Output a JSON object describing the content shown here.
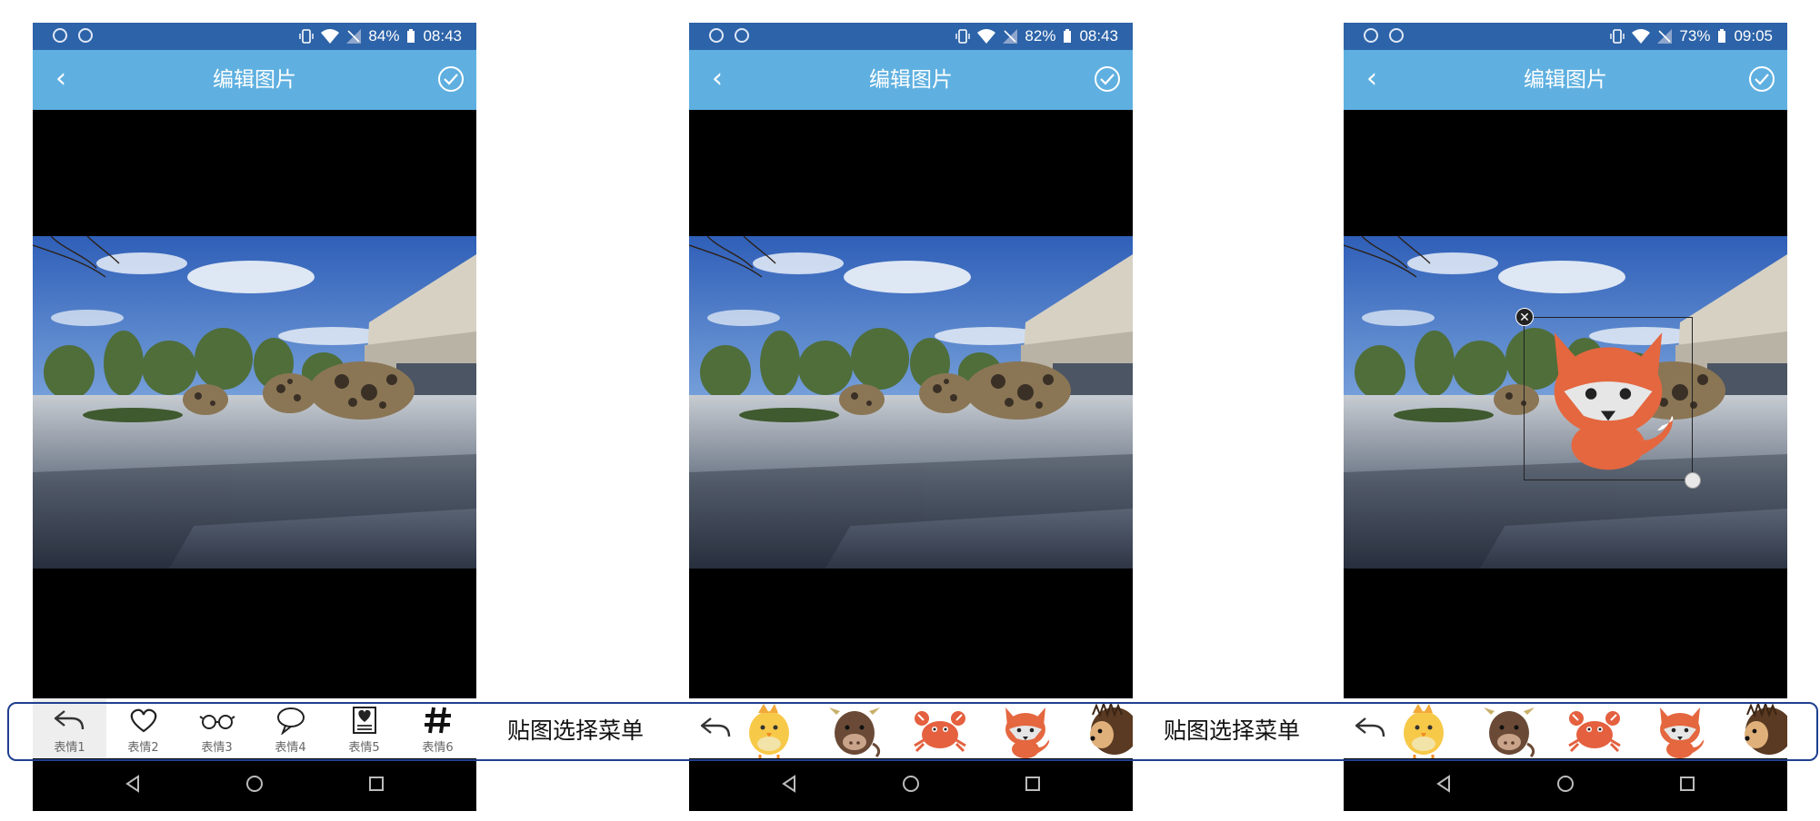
{
  "colors": {
    "status_bar": "#2d63a8",
    "app_bar": "#5fb0e0",
    "frame_border": "#1f3f8f"
  },
  "phones": [
    {
      "status": {
        "battery": "84%",
        "time": "08:43"
      },
      "app_bar": {
        "back_icon": "chevron-left-icon",
        "title": "编辑图片",
        "confirm_icon": "check-circle-icon"
      },
      "emoji_tabs": [
        {
          "label": "表情1",
          "icon": "undo-icon",
          "selected": true
        },
        {
          "label": "表情2",
          "icon": "heart-icon"
        },
        {
          "label": "表情3",
          "icon": "glasses-icon"
        },
        {
          "label": "表情4",
          "icon": "speech-bubble-icon"
        },
        {
          "label": "表情5",
          "icon": "heart-document-icon"
        },
        {
          "label": "表情6",
          "icon": "hash-icon"
        }
      ]
    },
    {
      "status": {
        "battery": "82%",
        "time": "08:43"
      },
      "app_bar": {
        "back_icon": "chevron-left-icon",
        "title": "编辑图片",
        "confirm_icon": "check-circle-icon"
      },
      "stickers": [
        "chick",
        "cow",
        "crab",
        "fox",
        "hedgehog"
      ]
    },
    {
      "status": {
        "battery": "73%",
        "time": "09:05"
      },
      "app_bar": {
        "back_icon": "chevron-left-icon",
        "title": "编辑图片",
        "confirm_icon": "check-circle-icon"
      },
      "stickers": [
        "chick",
        "cow",
        "crab",
        "fox",
        "hedgehog"
      ],
      "placed_sticker": "fox"
    }
  ],
  "annotations": {
    "menu_label_1": "贴图选择菜单",
    "menu_label_2": "贴图选择菜单"
  }
}
